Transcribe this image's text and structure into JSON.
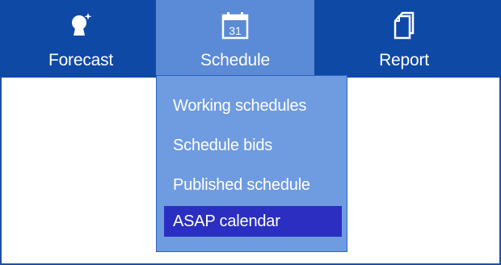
{
  "nav": {
    "items": [
      {
        "label": "Forecast",
        "icon": "forecast-icon"
      },
      {
        "label": "Schedule",
        "icon": "calendar-icon",
        "icon_text": "31",
        "selected": true
      },
      {
        "label": "Report",
        "icon": "report-icon"
      }
    ]
  },
  "dropdown": {
    "items": [
      {
        "label": "Working schedules"
      },
      {
        "label": "Schedule bids"
      },
      {
        "label": "Published schedule"
      },
      {
        "label": "ASAP calendar",
        "highlighted": true
      }
    ]
  },
  "colors": {
    "navbar": "#0f49a6",
    "selected_tab": "#5b8ad6",
    "dropdown_bg": "#6f9be0",
    "highlight": "#2a2fc2",
    "text": "#ffffff"
  }
}
